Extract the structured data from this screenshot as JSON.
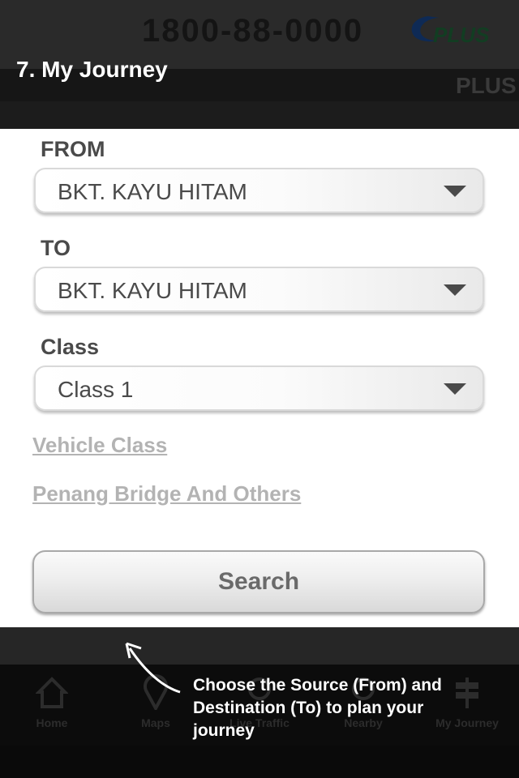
{
  "header": {
    "hotline": "1800-88-0000",
    "brand": "PLUS",
    "brand_sub": "PLUS",
    "step_title": "7. My Journey"
  },
  "form": {
    "from_label": "FROM",
    "from_value": "BKT. KAYU HITAM",
    "to_label": "TO",
    "to_value": "BKT. KAYU HITAM",
    "class_label": "Class",
    "class_value": "Class 1",
    "vehicle_class_link": "Vehicle Class",
    "penang_link": "Penang Bridge And Others",
    "search_label": "Search"
  },
  "tabs": [
    {
      "label": "Home",
      "icon": "home-icon"
    },
    {
      "label": "Maps",
      "icon": "map-pin-icon"
    },
    {
      "label": "Live Traffic",
      "icon": "traffic-icon"
    },
    {
      "label": "Nearby",
      "icon": "nearby-icon"
    },
    {
      "label": "My Journey",
      "icon": "signpost-icon"
    }
  ],
  "tutorial": {
    "text": "Choose the Source (From) and Destination (To) to plan your journey"
  },
  "colors": {
    "overlay": "#1c1c1c",
    "panel": "#ffffff",
    "label_text": "#4a4a4a",
    "link_text": "#b3b3b3",
    "brand_blue": "#1a3c7a",
    "brand_green": "#1f6b2a"
  }
}
